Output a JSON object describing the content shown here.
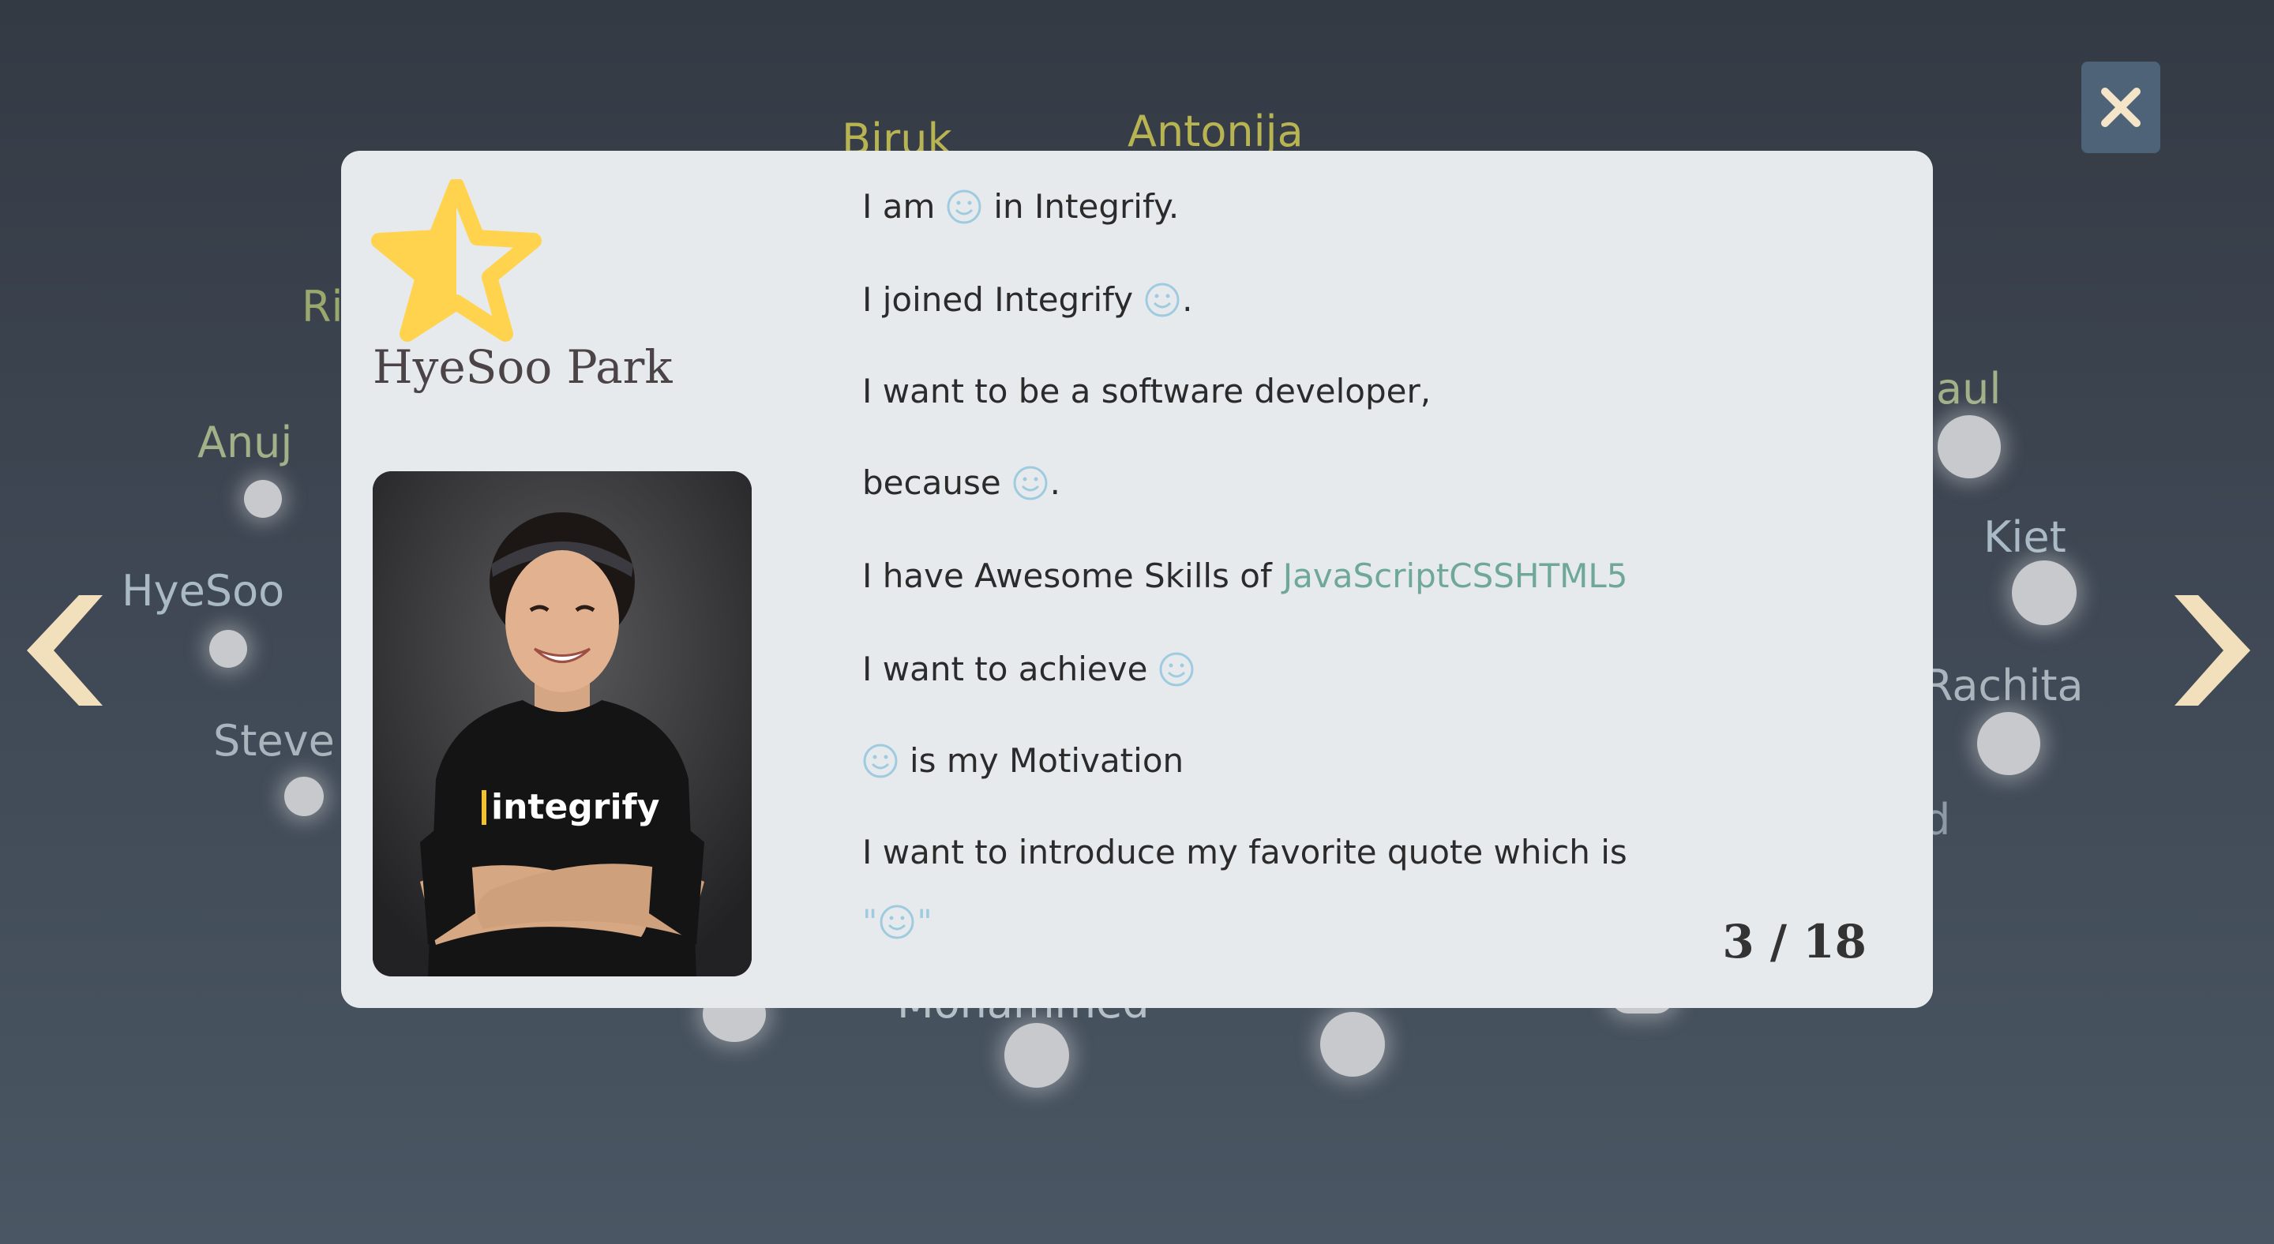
{
  "background_names": [
    "Biruk",
    "Antonija",
    "Ri",
    "Anuj",
    "HyeSoo",
    "Steve",
    "aul",
    "Kiet",
    "Rachita",
    "d",
    "Mohammed"
  ],
  "modal": {
    "person_name": "HyeSoo Park",
    "lines": {
      "l1_a": "I am",
      "l1_b": "in Integrify.",
      "l2_a": "I joined Integrify",
      "l2_b": ".",
      "l3": "I want to be a software developer,",
      "l4_a": "because",
      "l4_b": ".",
      "l5_a": "I have Awesome Skills of",
      "l5_skills": "JavaScriptCSSHTML5",
      "l6_a": "I want to achieve",
      "l7_b": "is my Motivation",
      "l8": "I want to introduce my favorite quote which is",
      "l9_open": "\"",
      "l9_close": "\""
    },
    "counter": "3 / 18",
    "photo_shirt_text": "integrify"
  },
  "icons": {
    "close": "close-icon",
    "prev": "chevron-left-icon",
    "next": "chevron-right-icon",
    "star": "half-star-icon",
    "smile": "smiley-icon"
  },
  "colors": {
    "accent_star": "#ffd34d",
    "arrow": "#f2dfbc",
    "skills": "#6fa89a",
    "smiley": "#9ecbe0"
  }
}
